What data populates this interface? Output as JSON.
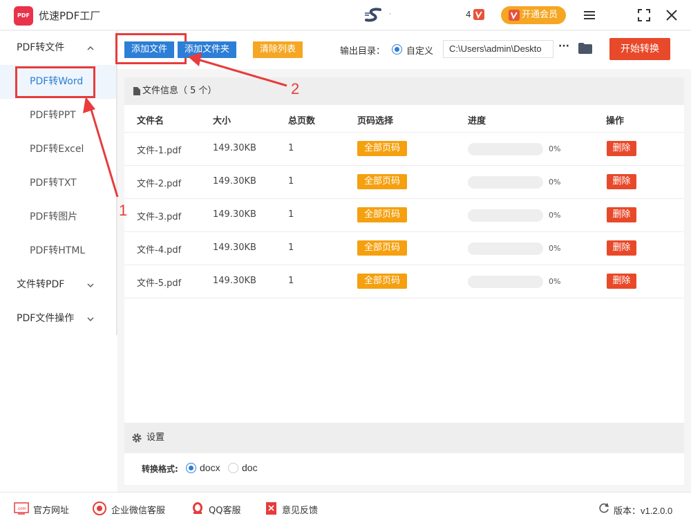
{
  "app": {
    "title": "优速PDF工厂",
    "logo_text": "PDF",
    "vip_count": "4",
    "vip_label": "开通会员"
  },
  "sidebar": {
    "groups": [
      {
        "label": "PDF转文件"
      },
      {
        "label": "文件转PDF"
      },
      {
        "label": "PDF文件操作"
      }
    ],
    "items": [
      {
        "label": "PDF转Word",
        "active": true
      },
      {
        "label": "PDF转PPT"
      },
      {
        "label": "PDF转Excel"
      },
      {
        "label": "PDF转TXT"
      },
      {
        "label": "PDF转图片"
      },
      {
        "label": "PDF转HTML"
      }
    ]
  },
  "toolbar": {
    "add_file": "添加文件",
    "add_folder": "添加文件夹",
    "clear_list": "清除列表",
    "output_label": "输出目录：",
    "custom_label": "自定义",
    "path_value": "C:\\Users\\admin\\Deskto",
    "more": "···",
    "start": "开始转换"
  },
  "file_panel": {
    "header": "文件信息（ 5 个）",
    "columns": [
      "文件名",
      "大小",
      "总页数",
      "页码选择",
      "进度",
      "操作"
    ],
    "rows": [
      {
        "name": "文件-1.pdf",
        "size": "149.30KB",
        "pages": "1",
        "page_select": "全部页码",
        "progress": 0,
        "progress_text": "0%",
        "action": "删除"
      },
      {
        "name": "文件-2.pdf",
        "size": "149.30KB",
        "pages": "1",
        "page_select": "全部页码",
        "progress": 0,
        "progress_text": "0%",
        "action": "删除"
      },
      {
        "name": "文件-3.pdf",
        "size": "149.30KB",
        "pages": "1",
        "page_select": "全部页码",
        "progress": 0,
        "progress_text": "0%",
        "action": "删除"
      },
      {
        "name": "文件-4.pdf",
        "size": "149.30KB",
        "pages": "1",
        "page_select": "全部页码",
        "progress": 0,
        "progress_text": "0%",
        "action": "删除"
      },
      {
        "name": "文件-5.pdf",
        "size": "149.30KB",
        "pages": "1",
        "page_select": "全部页码",
        "progress": 0,
        "progress_text": "0%",
        "action": "删除"
      }
    ]
  },
  "settings": {
    "title": "设置",
    "format_label": "转换格式:",
    "options": [
      "docx",
      "doc"
    ],
    "selected": "docx"
  },
  "annotations": {
    "step1": "1",
    "step2": "2"
  },
  "footer": {
    "website": "官方网址",
    "wechat": "企业微信客服",
    "qq": "QQ客服",
    "feedback": "意见反馈",
    "version": "版本：v1.2.0.0",
    "website_icon_text": ".com"
  },
  "colors": {
    "accent_blue": "#2c7ed6",
    "start_red": "#e8492a",
    "orange": "#f5a623",
    "annotation_red": "#e83b3b"
  }
}
